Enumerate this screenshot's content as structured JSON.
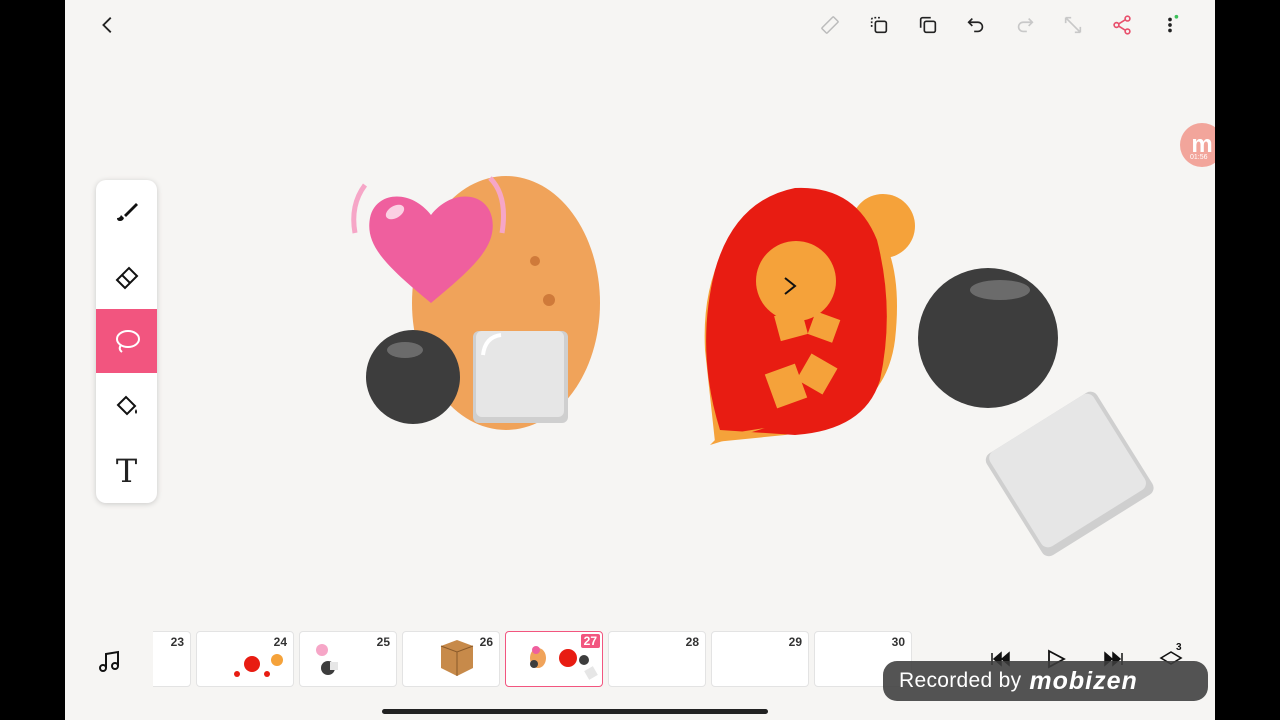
{
  "header": {
    "back_icon": "chevron-left-icon",
    "tools": [
      "ruler-icon",
      "duplicate-layer-icon",
      "copy-icon",
      "undo-icon",
      "redo-icon",
      "resize-icon",
      "share-icon",
      "more-vert-icon"
    ]
  },
  "toolbar": {
    "tools": [
      {
        "name": "brush",
        "icon": "brush-icon"
      },
      {
        "name": "eraser",
        "icon": "eraser-icon"
      },
      {
        "name": "lasso",
        "icon": "lasso-icon",
        "active": true
      },
      {
        "name": "fill",
        "icon": "paint-bucket-icon"
      },
      {
        "name": "text",
        "icon": "text-icon",
        "glyph": "T"
      }
    ]
  },
  "avatar_chip": {
    "letter": "m",
    "time": "01:56"
  },
  "timeline": {
    "music_icon": "music-note-icon",
    "frames": [
      {
        "number": "23"
      },
      {
        "number": "24"
      },
      {
        "number": "25"
      },
      {
        "number": "26"
      },
      {
        "number": "27",
        "active": true
      },
      {
        "number": "28"
      },
      {
        "number": "29"
      },
      {
        "number": "30"
      }
    ],
    "controls": [
      "skip-back-icon",
      "play-icon",
      "skip-forward-icon",
      "layers-icon"
    ],
    "layers_count": "3"
  },
  "watermark": {
    "prefix": "Recorded by",
    "brand": "mobizen"
  },
  "colors": {
    "accent": "#f2557f",
    "canvas": "#f6f5f3",
    "fire": "#e81c12",
    "orange": "#f5a23a",
    "share": "#e8506c"
  }
}
